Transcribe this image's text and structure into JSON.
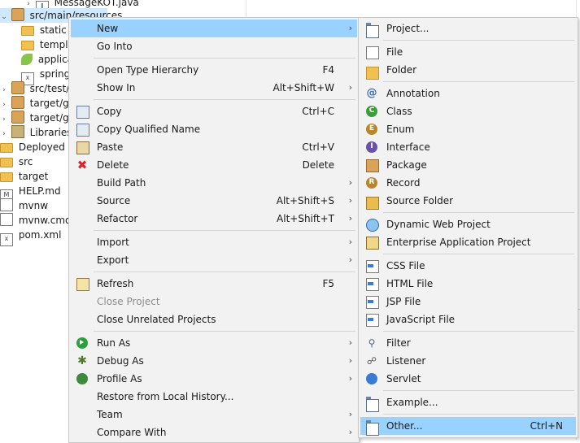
{
  "tree": {
    "items": [
      {
        "label": "MessageKOT.java",
        "twisty": "›",
        "icon": "java-file-icon"
      },
      {
        "label": "src/main/resources",
        "twisty": "⌄",
        "icon": "source-folder-icon"
      },
      {
        "label": "static",
        "twisty": "",
        "icon": "folder-icon"
      },
      {
        "label": "templat",
        "twisty": "",
        "icon": "folder-icon"
      },
      {
        "label": "applica",
        "twisty": "",
        "icon": "spring-leaf-icon"
      },
      {
        "label": "springb",
        "twisty": "",
        "icon": "xml-file-icon"
      },
      {
        "label": "src/test/jav",
        "twisty": "›",
        "icon": "source-folder-icon"
      },
      {
        "label": "target/gen",
        "twisty": "›",
        "icon": "source-folder-icon"
      },
      {
        "label": "target/gen",
        "twisty": "›",
        "icon": "source-folder-icon"
      },
      {
        "label": "Libraries",
        "twisty": "›",
        "icon": "library-icon"
      },
      {
        "label": "Deployed Res",
        "twisty": "",
        "icon": "deployed-resources-icon"
      },
      {
        "label": "src",
        "twisty": "",
        "icon": "folder-icon"
      },
      {
        "label": "target",
        "twisty": "",
        "icon": "folder-icon"
      },
      {
        "label": "HELP.md",
        "twisty": "",
        "icon": "markdown-file-icon"
      },
      {
        "label": "mvnw",
        "twisty": "",
        "icon": "file-icon"
      },
      {
        "label": "mvnw.cmd",
        "twisty": "",
        "icon": "file-icon"
      },
      {
        "label": "pom.xml",
        "twisty": "",
        "icon": "xml-file-icon"
      }
    ]
  },
  "context_menu": {
    "items": [
      {
        "label": "New",
        "shortcut": "",
        "submenu": true,
        "icon": ""
      },
      {
        "label": "Go Into",
        "shortcut": "",
        "submenu": false,
        "icon": ""
      },
      {
        "label": "Open Type Hierarchy",
        "shortcut": "F4",
        "submenu": false,
        "icon": ""
      },
      {
        "label": "Show In",
        "shortcut": "Alt+Shift+W",
        "submenu": true,
        "icon": ""
      },
      {
        "label": "Copy",
        "shortcut": "Ctrl+C",
        "submenu": false,
        "icon": "copy-icon"
      },
      {
        "label": "Copy Qualified Name",
        "shortcut": "",
        "submenu": false,
        "icon": "copy-icon"
      },
      {
        "label": "Paste",
        "shortcut": "Ctrl+V",
        "submenu": false,
        "icon": "paste-icon"
      },
      {
        "label": "Delete",
        "shortcut": "Delete",
        "submenu": false,
        "icon": "delete-icon"
      },
      {
        "label": "Build Path",
        "shortcut": "",
        "submenu": true,
        "icon": ""
      },
      {
        "label": "Source",
        "shortcut": "Alt+Shift+S",
        "submenu": true,
        "icon": ""
      },
      {
        "label": "Refactor",
        "shortcut": "Alt+Shift+T",
        "submenu": true,
        "icon": ""
      },
      {
        "label": "Import",
        "shortcut": "",
        "submenu": true,
        "icon": ""
      },
      {
        "label": "Export",
        "shortcut": "",
        "submenu": true,
        "icon": ""
      },
      {
        "label": "Refresh",
        "shortcut": "F5",
        "submenu": false,
        "icon": "refresh-icon"
      },
      {
        "label": "Close Project",
        "shortcut": "",
        "submenu": false,
        "icon": ""
      },
      {
        "label": "Close Unrelated Projects",
        "shortcut": "",
        "submenu": false,
        "icon": ""
      },
      {
        "label": "Run As",
        "shortcut": "",
        "submenu": true,
        "icon": "run-icon"
      },
      {
        "label": "Debug As",
        "shortcut": "",
        "submenu": true,
        "icon": "debug-icon"
      },
      {
        "label": "Profile As",
        "shortcut": "",
        "submenu": true,
        "icon": "profile-icon"
      },
      {
        "label": "Restore from Local History...",
        "shortcut": "",
        "submenu": false,
        "icon": ""
      },
      {
        "label": "Team",
        "shortcut": "",
        "submenu": true,
        "icon": ""
      },
      {
        "label": "Compare With",
        "shortcut": "",
        "submenu": true,
        "icon": ""
      }
    ]
  },
  "new_submenu": {
    "items": [
      {
        "label": "Project...",
        "shortcut": "",
        "icon": "new-project-icon"
      },
      {
        "label": "File",
        "shortcut": "",
        "icon": "new-file-icon"
      },
      {
        "label": "Folder",
        "shortcut": "",
        "icon": "new-folder-icon"
      },
      {
        "label": "Annotation",
        "shortcut": "",
        "icon": "annotation-icon",
        "glyph": "@"
      },
      {
        "label": "Class",
        "shortcut": "",
        "icon": "class-icon",
        "glyph": "C"
      },
      {
        "label": "Enum",
        "shortcut": "",
        "icon": "enum-icon",
        "glyph": "E"
      },
      {
        "label": "Interface",
        "shortcut": "",
        "icon": "interface-icon",
        "glyph": "I"
      },
      {
        "label": "Package",
        "shortcut": "",
        "icon": "package-icon"
      },
      {
        "label": "Record",
        "shortcut": "",
        "icon": "record-icon",
        "glyph": "R"
      },
      {
        "label": "Source Folder",
        "shortcut": "",
        "icon": "source-folder-icon"
      },
      {
        "label": "Dynamic Web Project",
        "shortcut": "",
        "icon": "web-project-icon"
      },
      {
        "label": "Enterprise Application Project",
        "shortcut": "",
        "icon": "enterprise-project-icon"
      },
      {
        "label": "CSS File",
        "shortcut": "",
        "icon": "css-file-icon"
      },
      {
        "label": "HTML File",
        "shortcut": "",
        "icon": "html-file-icon"
      },
      {
        "label": "JSP File",
        "shortcut": "",
        "icon": "jsp-file-icon"
      },
      {
        "label": "JavaScript File",
        "shortcut": "",
        "icon": "javascript-file-icon"
      },
      {
        "label": "Filter",
        "shortcut": "",
        "icon": "filter-icon"
      },
      {
        "label": "Listener",
        "shortcut": "",
        "icon": "listener-icon"
      },
      {
        "label": "Servlet",
        "shortcut": "",
        "icon": "servlet-icon"
      },
      {
        "label": "Example...",
        "shortcut": "",
        "icon": "example-icon"
      },
      {
        "label": "Other...",
        "shortcut": "Ctrl+N",
        "icon": "other-wizard-icon"
      }
    ]
  },
  "colors": {
    "highlight": "#99d1ff",
    "menu_bg": "#f2f2f2",
    "disabled_text": "#8c8c8c",
    "tree_selection": "#cde8ff"
  },
  "glyphs": {
    "submenu_arrow": "›",
    "delete": "✖",
    "debug": "✱",
    "filter": "⚲",
    "listener": "☍"
  }
}
